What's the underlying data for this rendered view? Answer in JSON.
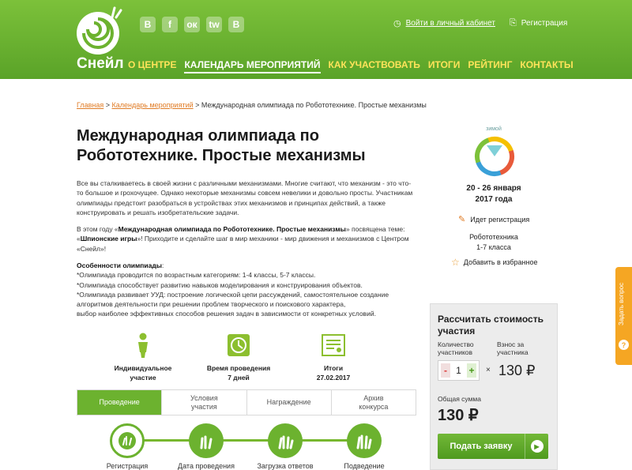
{
  "brand": "Снейл",
  "social": [
    "В",
    "f",
    "ок",
    "tw",
    "B"
  ],
  "nav": [
    {
      "label": "О ЦЕНТРЕ",
      "active": false
    },
    {
      "label": "КАЛЕНДАРЬ МЕРОПРИЯТИЙ",
      "active": true
    },
    {
      "label": "КАК УЧАСТВОВАТЬ",
      "active": false
    },
    {
      "label": "ИТОГИ",
      "active": false
    },
    {
      "label": "РЕЙТИНГ",
      "active": false
    },
    {
      "label": "КОНТАКТЫ",
      "active": false
    }
  ],
  "top_links": {
    "login": "Войти в личный кабинет",
    "register": "Регистрация"
  },
  "breadcrumb": {
    "home": "Главная",
    "calendar": "Календарь мероприятий",
    "sep": " > ",
    "current": "Международная олимпиада по Робототехнике. Простые механизмы"
  },
  "title": "Международная олимпиада по Робототехнике. Простые механизмы",
  "intro": "Все вы сталкиваетесь в своей жизни с различными механизмами. Многие считают, что механизм - это что-то большое и грохочущее. Однако некоторые механизмы совсем невелики и довольно просты. Участникам олимпиады предстоит разобраться в устройствах этих механизмов и принципах действий, а также конструировать и решать изобретательские задачи.",
  "theme": {
    "p1": "В этом году «",
    "b1": "Международная олимпиада по Робототехнике. Простые механизмы",
    "p2": "» посвящена теме: «",
    "b2": "Шпионские игры",
    "p3": "»! Приходите и сделайте шаг в мир механики - мир движения и механизмов с Центром «Снейл»!"
  },
  "features": {
    "title": "Особенности олимпиады",
    "colon": ":",
    "items": [
      "*Олимпиада проводится по возрастным категориям: 1-4 классы, 5-7 классы.",
      "*Олимпиада способствует развитию навыков моделирования и конструирования объектов.",
      "*Олимпиада развивает УУД: построение логической цепи рассуждений, самостоятельное создание алгоритмов деятельности при решении проблем творческого и поискового характера,",
      "выбор наиболее эффективных способов решения задач в зависимости от конкретных условий."
    ]
  },
  "info": [
    {
      "line1": "Индивидуальное",
      "line2": "участие"
    },
    {
      "line1": "Время проведения",
      "line2": "7 дней"
    },
    {
      "line1": "Итоги",
      "line2": "27.02.2017"
    }
  ],
  "tabs": [
    {
      "label": "Проведение",
      "active": true
    },
    {
      "label": "Условия участия",
      "active": false
    },
    {
      "label": "Награждение",
      "active": false
    },
    {
      "label": "Архив конкурса",
      "active": false
    }
  ],
  "stages": [
    "Регистрация",
    "Дата проведения",
    "Загрузка ответов",
    "Подведение итогов"
  ],
  "season": "зимой",
  "dates": {
    "line1": "20 - 26 января",
    "line2": "2017 года"
  },
  "registration_status": "Идет регистрация",
  "category": {
    "line1": "Робототехника",
    "line2": "1-7 класса"
  },
  "favorite": "Добавить в избранное",
  "calc": {
    "title": "Рассчитать стоимость участия",
    "qty_label": "Количество участников",
    "fee_label": "Взнос за участника",
    "minus": "-",
    "plus": "+",
    "qty": "1",
    "mult": "×",
    "fee": "130 ₽",
    "total_label": "Общая сумма",
    "total": "130 ₽",
    "apply": "Подать заявку"
  },
  "ask": "Задать вопрос",
  "ask_icon": "?"
}
